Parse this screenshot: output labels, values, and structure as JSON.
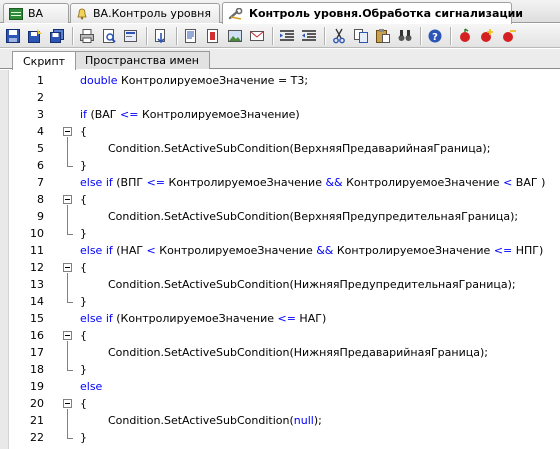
{
  "doc_tabs": [
    {
      "label": "ВА",
      "icon": "table-icon"
    },
    {
      "label": "ВА.Контроль уровня",
      "icon": "bell-icon"
    },
    {
      "label": "Контроль уровня.Обработка сигнализации",
      "icon": "wrench-icon"
    }
  ],
  "toolbar": {
    "buttons": [
      "save-icon",
      "save-as-icon",
      "save-all-icon",
      "print-icon",
      "print-preview-icon",
      "export-icon",
      "import-icon",
      "document-icon",
      "bookmark-icon",
      "image-icon",
      "email-icon",
      "indent-icon",
      "outdent-icon",
      "cut-icon",
      "copy-icon",
      "paste-icon",
      "find-icon",
      "help-icon",
      "breakpoint-icon",
      "breakpoint-add-icon",
      "breakpoint-remove-icon"
    ]
  },
  "inner_tabs": [
    {
      "label": "Скрипт"
    },
    {
      "label": "Пространства имен"
    }
  ],
  "code_lines": [
    {
      "n": "1",
      "parts": [
        [
          "kw",
          "double "
        ],
        [
          "t",
          "КонтролируемоеЗначение = Т3;"
        ]
      ]
    },
    {
      "n": "2",
      "parts": []
    },
    {
      "n": "3",
      "parts": [
        [
          "kw",
          "if "
        ],
        [
          "t",
          "(ВАГ "
        ],
        [
          "op",
          "<="
        ],
        [
          "t",
          " КонтролируемоеЗначение)"
        ]
      ]
    },
    {
      "n": "4",
      "parts": [
        [
          "t",
          "{"
        ]
      ]
    },
    {
      "n": "5",
      "parts": [
        [
          "t",
          "        Condition.SetActiveSubCondition(ВерхняяПредаварийнаяГраница);"
        ]
      ]
    },
    {
      "n": "6",
      "parts": [
        [
          "t",
          "}"
        ]
      ]
    },
    {
      "n": "7",
      "parts": [
        [
          "kw",
          "else if "
        ],
        [
          "t",
          "(ВПГ "
        ],
        [
          "op",
          "<="
        ],
        [
          "t",
          " КонтролируемоеЗначение "
        ],
        [
          "op",
          "&&"
        ],
        [
          "t",
          " КонтролируемоеЗначение "
        ],
        [
          "op",
          "<"
        ],
        [
          "t",
          " ВАГ )"
        ]
      ]
    },
    {
      "n": "8",
      "parts": [
        [
          "t",
          "{"
        ]
      ]
    },
    {
      "n": "9",
      "parts": [
        [
          "t",
          "        Condition.SetActiveSubCondition(ВерхняяПредупредительнаяГраница);"
        ]
      ]
    },
    {
      "n": "10",
      "parts": [
        [
          "t",
          "}"
        ]
      ]
    },
    {
      "n": "11",
      "parts": [
        [
          "kw",
          "else if "
        ],
        [
          "t",
          "(НАГ "
        ],
        [
          "op",
          "<"
        ],
        [
          "t",
          " КонтролируемоеЗначение "
        ],
        [
          "op",
          "&&"
        ],
        [
          "t",
          " КонтролируемоеЗначение "
        ],
        [
          "op",
          "<="
        ],
        [
          "t",
          " НПГ)"
        ]
      ]
    },
    {
      "n": "12",
      "parts": [
        [
          "t",
          "{"
        ]
      ]
    },
    {
      "n": "13",
      "parts": [
        [
          "t",
          "        Condition.SetActiveSubCondition(НижняяПредупредительнаяГраница);"
        ]
      ]
    },
    {
      "n": "14",
      "parts": [
        [
          "t",
          "}"
        ]
      ]
    },
    {
      "n": "15",
      "parts": [
        [
          "kw",
          "else if "
        ],
        [
          "t",
          "(КонтролируемоеЗначение "
        ],
        [
          "op",
          "<="
        ],
        [
          "t",
          " НАГ)"
        ]
      ]
    },
    {
      "n": "16",
      "parts": [
        [
          "t",
          "{"
        ]
      ]
    },
    {
      "n": "17",
      "parts": [
        [
          "t",
          "        Condition.SetActiveSubCondition(НижняяПредаварийнаяГраница);"
        ]
      ]
    },
    {
      "n": "18",
      "parts": [
        [
          "t",
          "}"
        ]
      ]
    },
    {
      "n": "19",
      "parts": [
        [
          "kw",
          "else"
        ]
      ]
    },
    {
      "n": "20",
      "parts": [
        [
          "t",
          "{"
        ]
      ]
    },
    {
      "n": "21",
      "parts": [
        [
          "t",
          "        Condition.SetActiveSubCondition("
        ],
        [
          "kw",
          "null"
        ],
        [
          "t",
          ");"
        ]
      ]
    },
    {
      "n": "22",
      "parts": [
        [
          "t",
          "}"
        ]
      ]
    }
  ],
  "colors": {
    "keyword": "#0000ff",
    "text": "#000000",
    "gutter": "#e9e9e9"
  }
}
